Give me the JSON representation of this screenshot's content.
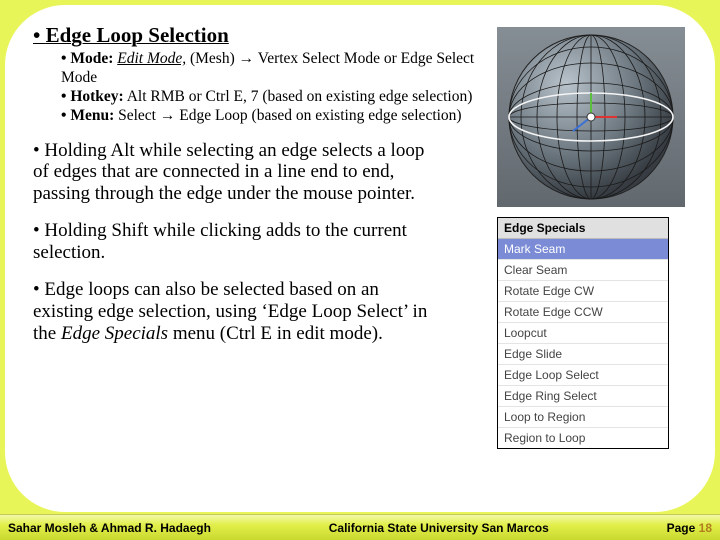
{
  "title": "Edge Loop Selection",
  "sub": {
    "mode_label": "Mode:",
    "mode_value": "Edit Mode,",
    "mode_tail": " (Mesh) → Vertex Select Mode or Edge Select Mode",
    "hotkey_label": "Hotkey:",
    "hotkey_value": " Alt RMB or Ctrl E, 7 (based on existing edge selection)",
    "menu_label": "Menu:",
    "menu_value": " Select → Edge Loop (based on existing edge selection)"
  },
  "body": {
    "b1": "Holding Alt while selecting an edge selects a loop of edges that are connected in a line end to end, passing through the edge under the mouse pointer.",
    "b2": "Holding Shift while clicking adds to the current selection.",
    "b3_a": "Edge loops can also be selected based on an existing edge selection, using ‘Edge Loop Select’ in the ",
    "b3_i": "Edge Specials",
    "b3_b": " menu (Ctrl E in edit mode)."
  },
  "menu": {
    "title": "Edge Specials",
    "items": [
      "Mark Seam",
      "Clear Seam",
      "Rotate Edge CW",
      "Rotate Edge CCW",
      "Loopcut",
      "Edge Slide",
      "Edge Loop Select",
      "Edge Ring Select",
      "Loop to Region",
      "Region to Loop"
    ]
  },
  "footer": {
    "left": "Sahar Mosleh & Ahmad R. Hadaegh",
    "center": "California State University San Marcos",
    "page_label": "Page",
    "page_num": "18"
  }
}
